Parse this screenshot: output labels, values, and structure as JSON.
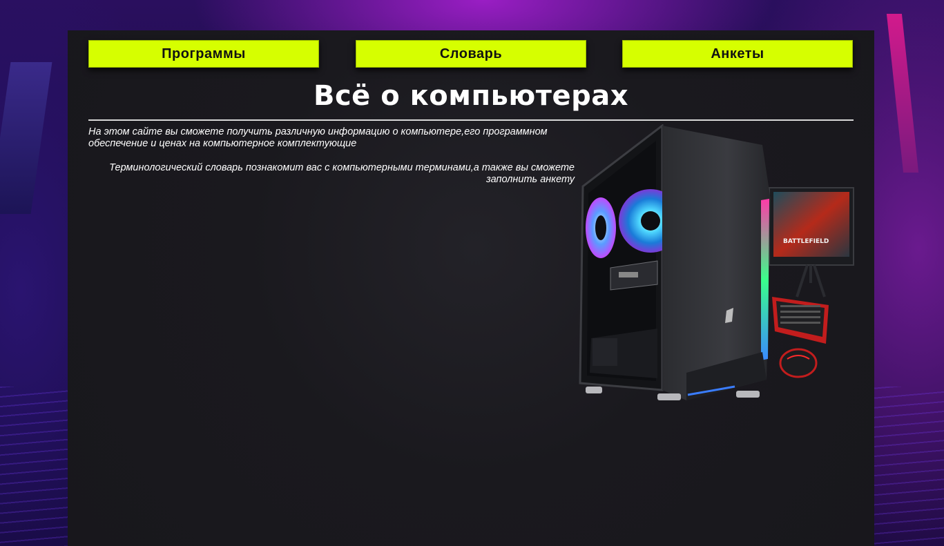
{
  "nav": {
    "items": [
      {
        "label": "Программы"
      },
      {
        "label": "Словарь"
      },
      {
        "label": "Анкеты"
      }
    ]
  },
  "header": {
    "title": "Всё о компьютерах"
  },
  "content": {
    "intro_text": "На этом сайте вы сможете получить различную информацию о компьютере,его программном обеспечение и ценах на компьютерное комплектующие",
    "dictionary_text": "Терминологический словарь познакомит вас с компьютерными терминами,а также вы сможете заполнить анкету"
  },
  "image": {
    "screen_text": "BATTLEFIELD"
  },
  "colors": {
    "nav_button": "#d6ff00",
    "panel": "#1a191e",
    "text": "#ffffff"
  }
}
